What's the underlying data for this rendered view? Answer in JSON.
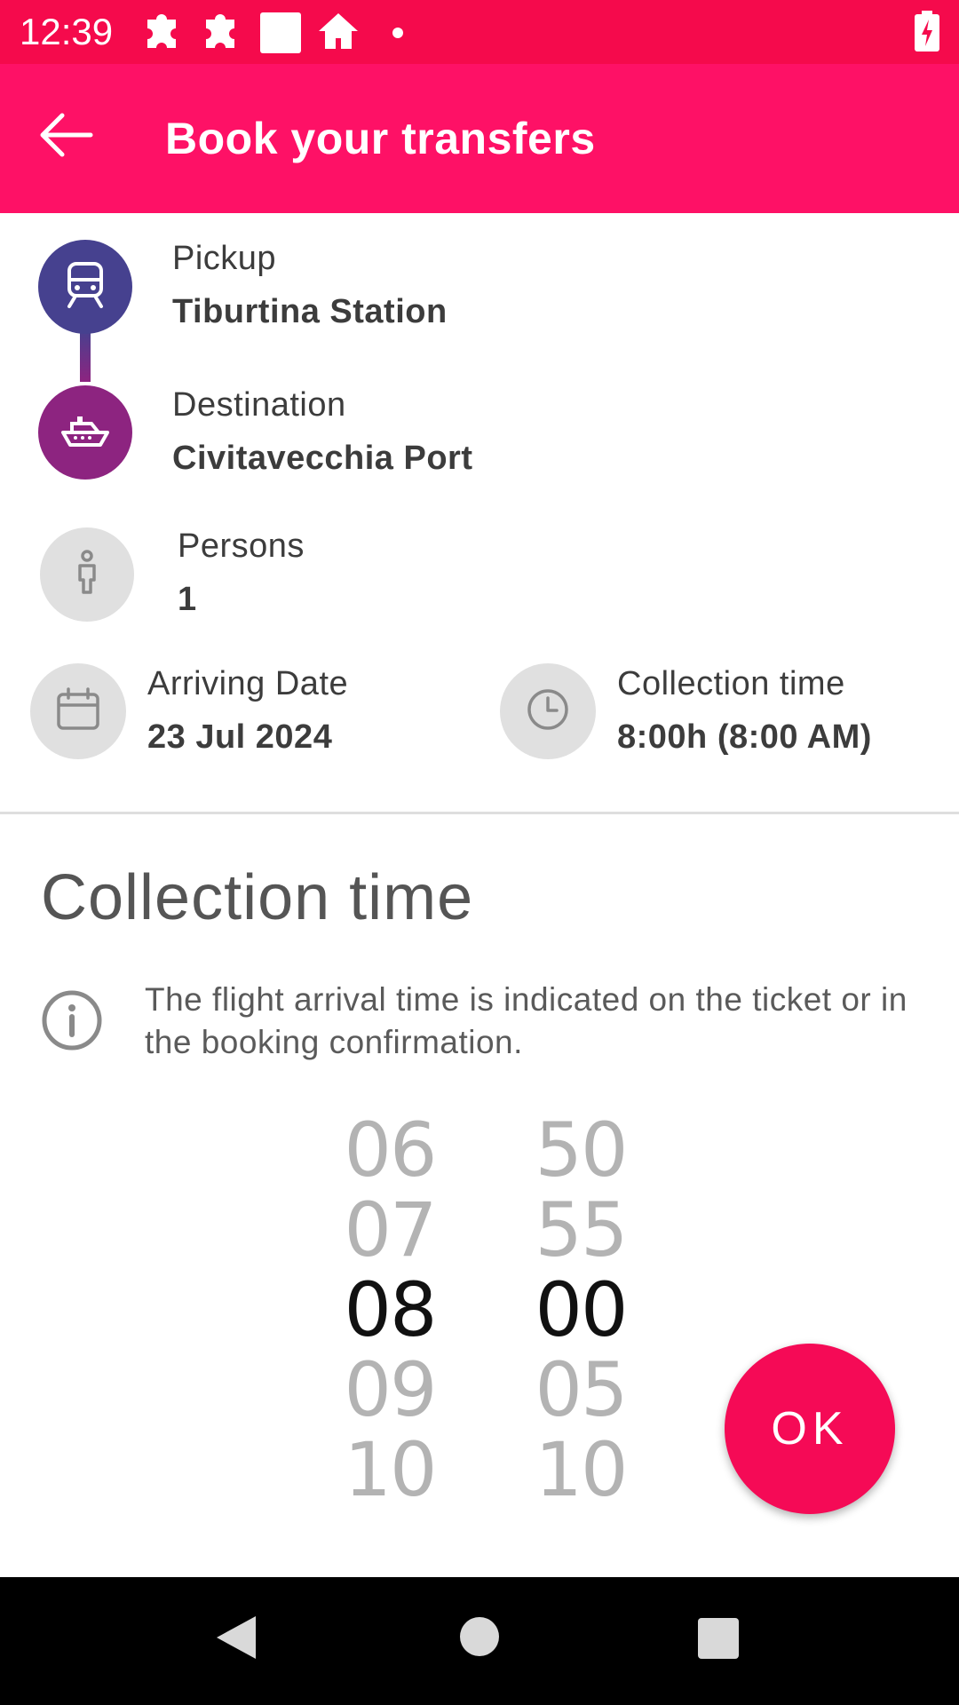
{
  "status_bar": {
    "time": "12:39",
    "icons": [
      "puzzle-icon",
      "puzzle-icon",
      "square-icon",
      "home-icon",
      "dot-icon",
      "battery-charging-icon"
    ]
  },
  "app_bar": {
    "title": "Book your transfers",
    "back_icon": "arrow-left-icon"
  },
  "pickup": {
    "label": "Pickup",
    "value": "Tiburtina Station",
    "icon": "train-icon"
  },
  "destination": {
    "label": "Destination",
    "value": "Civitavecchia Port",
    "icon": "ship-icon"
  },
  "persons": {
    "label": "Persons",
    "value": "1",
    "icon": "person-icon"
  },
  "arriving_date": {
    "label": "Arriving Date",
    "value": "23 Jul 2024",
    "icon": "calendar-icon"
  },
  "collection_time": {
    "label": "Collection time",
    "value": "8:00h (8:00 AM)",
    "icon": "clock-icon"
  },
  "sheet": {
    "title": "Collection time",
    "info_icon": "info-icon",
    "info_text": "The flight arrival time is indicated on the ticket or in the booking confirmation."
  },
  "time_picker": {
    "hours": [
      "06",
      "07",
      "08",
      "09",
      "10"
    ],
    "minutes": [
      "50",
      "55",
      "00",
      "05",
      "10"
    ],
    "selected_hour": "08",
    "selected_minute": "00"
  },
  "ok_button": {
    "label": "OK"
  },
  "nav_bar": {
    "icons": [
      "back-triangle-icon",
      "home-circle-icon",
      "recents-square-icon"
    ]
  },
  "colors": {
    "status_bar": "#f50a4c",
    "app_bar": "#fe1166",
    "pickup_circle": "#46418f",
    "destination_circle": "#8d2480",
    "ok_button": "#f50a56"
  }
}
